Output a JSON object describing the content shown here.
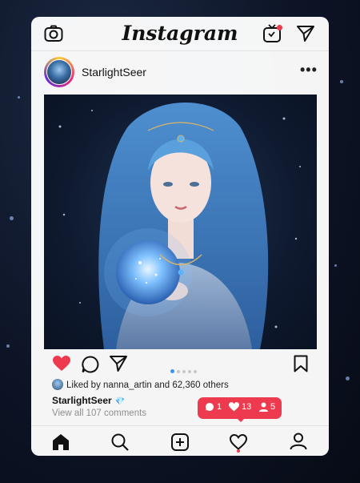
{
  "app": {
    "title": "Instagram"
  },
  "post": {
    "username": "StarlightSeer",
    "likes_text_prefix": "Liked by ",
    "liked_by_user": "nanna_artin",
    "likes_text_suffix": " and 62,360 others",
    "caption_username": "StarlightSeer",
    "caption_emoji": "💎",
    "view_comments": "View all 107 comments",
    "carousel": {
      "total": 5,
      "active": 0
    }
  },
  "notification_bubble": {
    "comments": "1",
    "likes": "13",
    "followers": "5"
  },
  "colors": {
    "like_red": "#ee3a4e",
    "carousel_blue": "#3897f0"
  }
}
